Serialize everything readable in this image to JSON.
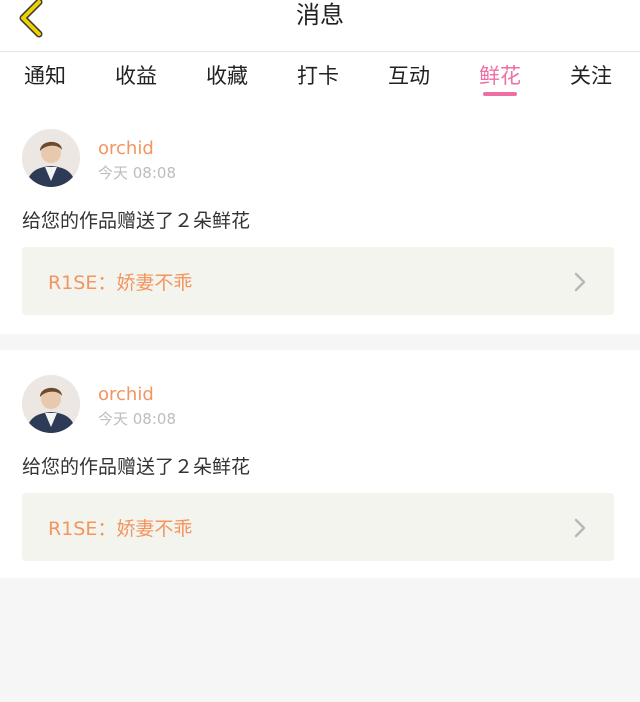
{
  "header": {
    "title": "消息",
    "back_icon": "chevron-left-icon",
    "accent": "#f0d100"
  },
  "tabs": [
    {
      "label": "通知"
    },
    {
      "label": "收益"
    },
    {
      "label": "收藏"
    },
    {
      "label": "打卡"
    },
    {
      "label": "互动"
    },
    {
      "label": "鲜花",
      "active": true
    },
    {
      "label": "关注"
    }
  ],
  "colors": {
    "active_tab": "#ee6fa2",
    "username": "#f2955f",
    "timestamp": "#bdbdbd",
    "work_bg": "#f4f4ee"
  },
  "messages": [
    {
      "username": "orchid",
      "time": "今天 08:08",
      "text": "给您的作品赠送了２朵鲜花",
      "work_title": "R1SE：娇妻不乖"
    },
    {
      "username": "orchid",
      "time": "今天 08:08",
      "text": "给您的作品赠送了２朵鲜花",
      "work_title": "R1SE：娇妻不乖"
    }
  ]
}
